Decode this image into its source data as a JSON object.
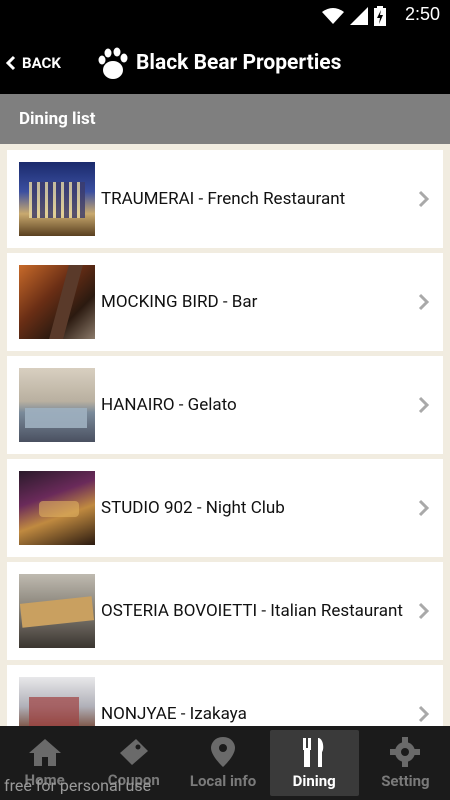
{
  "status_bar": {
    "time": "2:50"
  },
  "header": {
    "back_label": "BACK",
    "title": "Black Bear Properties"
  },
  "subheader": {
    "title": "Dining list"
  },
  "dining": [
    {
      "name": "TRAUMERAI - French Restaurant"
    },
    {
      "name": "MOCKING BIRD - Bar"
    },
    {
      "name": "HANAIRO - Gelato"
    },
    {
      "name": "STUDIO 902 - Night Club"
    },
    {
      "name": "OSTERIA BOVOIETTI - Italian Restaurant"
    },
    {
      "name": "NONJYAE - Izakaya"
    }
  ],
  "tabs": [
    {
      "label": "Home",
      "icon": "home-icon"
    },
    {
      "label": "Coupon",
      "icon": "ticket-icon"
    },
    {
      "label": "Local info",
      "icon": "map-pin-icon"
    },
    {
      "label": "Dining",
      "icon": "fork-knife-icon",
      "active": true
    },
    {
      "label": "Setting",
      "icon": "gear-icon"
    }
  ],
  "watermark": "free for personal use",
  "colors": {
    "header_bg": "#000000",
    "subheader_bg": "#7f7f7f",
    "list_bg": "#f1ece0",
    "tab_bg": "#1b1b1b",
    "tab_active": "#3a3a3a"
  }
}
